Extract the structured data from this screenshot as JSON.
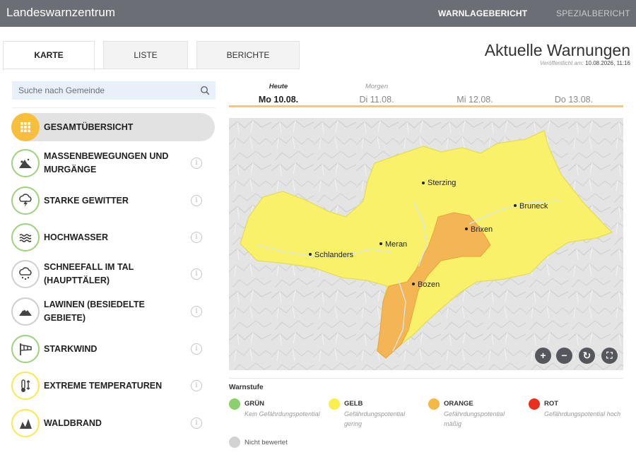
{
  "header": {
    "brand": "Landeswarnzentrum",
    "nav": [
      "WARNLAGEBERICHT",
      "SPEZIALBERICHT"
    ]
  },
  "tabs": [
    "KARTE",
    "LISTE",
    "BERICHTE"
  ],
  "page_title": "Aktuelle Warnungen",
  "published_label": "Veröffentlicht am:",
  "published_value": "10.08.2026, 11:16",
  "search": {
    "placeholder": "Suche nach Gemeinde"
  },
  "categories": [
    {
      "label": "GESAMTÜBERSICHT",
      "icon": "grid-icon",
      "active": true
    },
    {
      "label": "MASSENBEWEGUNGEN UND MURGÄNGE",
      "icon": "landslide-icon"
    },
    {
      "label": "STARKE GEWITTER",
      "icon": "thunderstorm-icon"
    },
    {
      "label": "HOCHWASSER",
      "icon": "flood-icon"
    },
    {
      "label": "SCHNEEFALL IM TAL (HAUPTTÄLER)",
      "icon": "snowfall-icon"
    },
    {
      "label": "LAWINEN (BESIEDELTE GEBIETE)",
      "icon": "avalanche-icon"
    },
    {
      "label": "STARKWIND",
      "icon": "windsock-icon"
    },
    {
      "label": "EXTREME TEMPERATUREN",
      "icon": "thermometer-icon"
    },
    {
      "label": "WALDBRAND",
      "icon": "forest-fire-icon"
    }
  ],
  "info_glyph": "i",
  "days": [
    {
      "rel": "Heute",
      "date": "Mo 10.08.",
      "active": true
    },
    {
      "rel": "Morgen",
      "date": "Di 11.08."
    },
    {
      "rel": "",
      "date": "Mi 12.08."
    },
    {
      "rel": "",
      "date": "Do 13.08."
    }
  ],
  "map": {
    "towns": [
      "Sterzing",
      "Bruneck",
      "Brixen",
      "Meran",
      "Schlanders",
      "Bozen"
    ],
    "controls": [
      "+",
      "−",
      "↻",
      "⛶"
    ]
  },
  "legend": {
    "title": "Warnstufe",
    "levels": [
      {
        "name": "GRÜN",
        "desc": "Kein Gefährdungspotential",
        "color": "#8cd06e"
      },
      {
        "name": "GELB",
        "desc": "Gefährdungspotential gering",
        "color": "#fbef4c"
      },
      {
        "name": "ORANGE",
        "desc": "Gefährdungspotential mäßig",
        "color": "#f6b845"
      },
      {
        "name": "ROT",
        "desc": "Gefährdungspotential hoch",
        "color": "#ea2f1c"
      }
    ],
    "unrated": "Nicht bewertet",
    "unrated_color": "#d2d2d2"
  },
  "colors": {
    "topbar": "#6b6e75",
    "accent": "#f7bf3b",
    "region_yellow": "#f8f169",
    "region_orange": "#f4b654"
  }
}
